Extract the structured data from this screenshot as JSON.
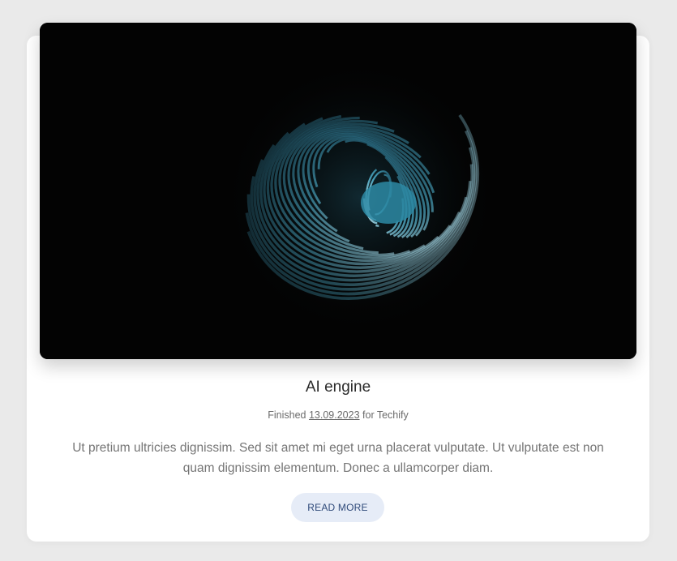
{
  "project": {
    "title": "AI engine",
    "meta_prefix": "Finished",
    "date": "13.09.2023",
    "meta_suffix": "for Techify",
    "description": "Ut pretium ultricies dignissim. Sed sit amet mi eget urna placerat vulputate. Ut vulputate est non quam dignissim elementum. Donec a ullamcorper diam.",
    "button_label": "READ MORE"
  },
  "image": {
    "subject": "abstract-3d-spiral",
    "background_color": "#030303",
    "accent_color": "#4aa7c2"
  },
  "colors": {
    "page_background": "#eaeaea",
    "card_background": "#ffffff",
    "button_background": "#e6ecf7",
    "button_text": "#2f4a7a"
  }
}
